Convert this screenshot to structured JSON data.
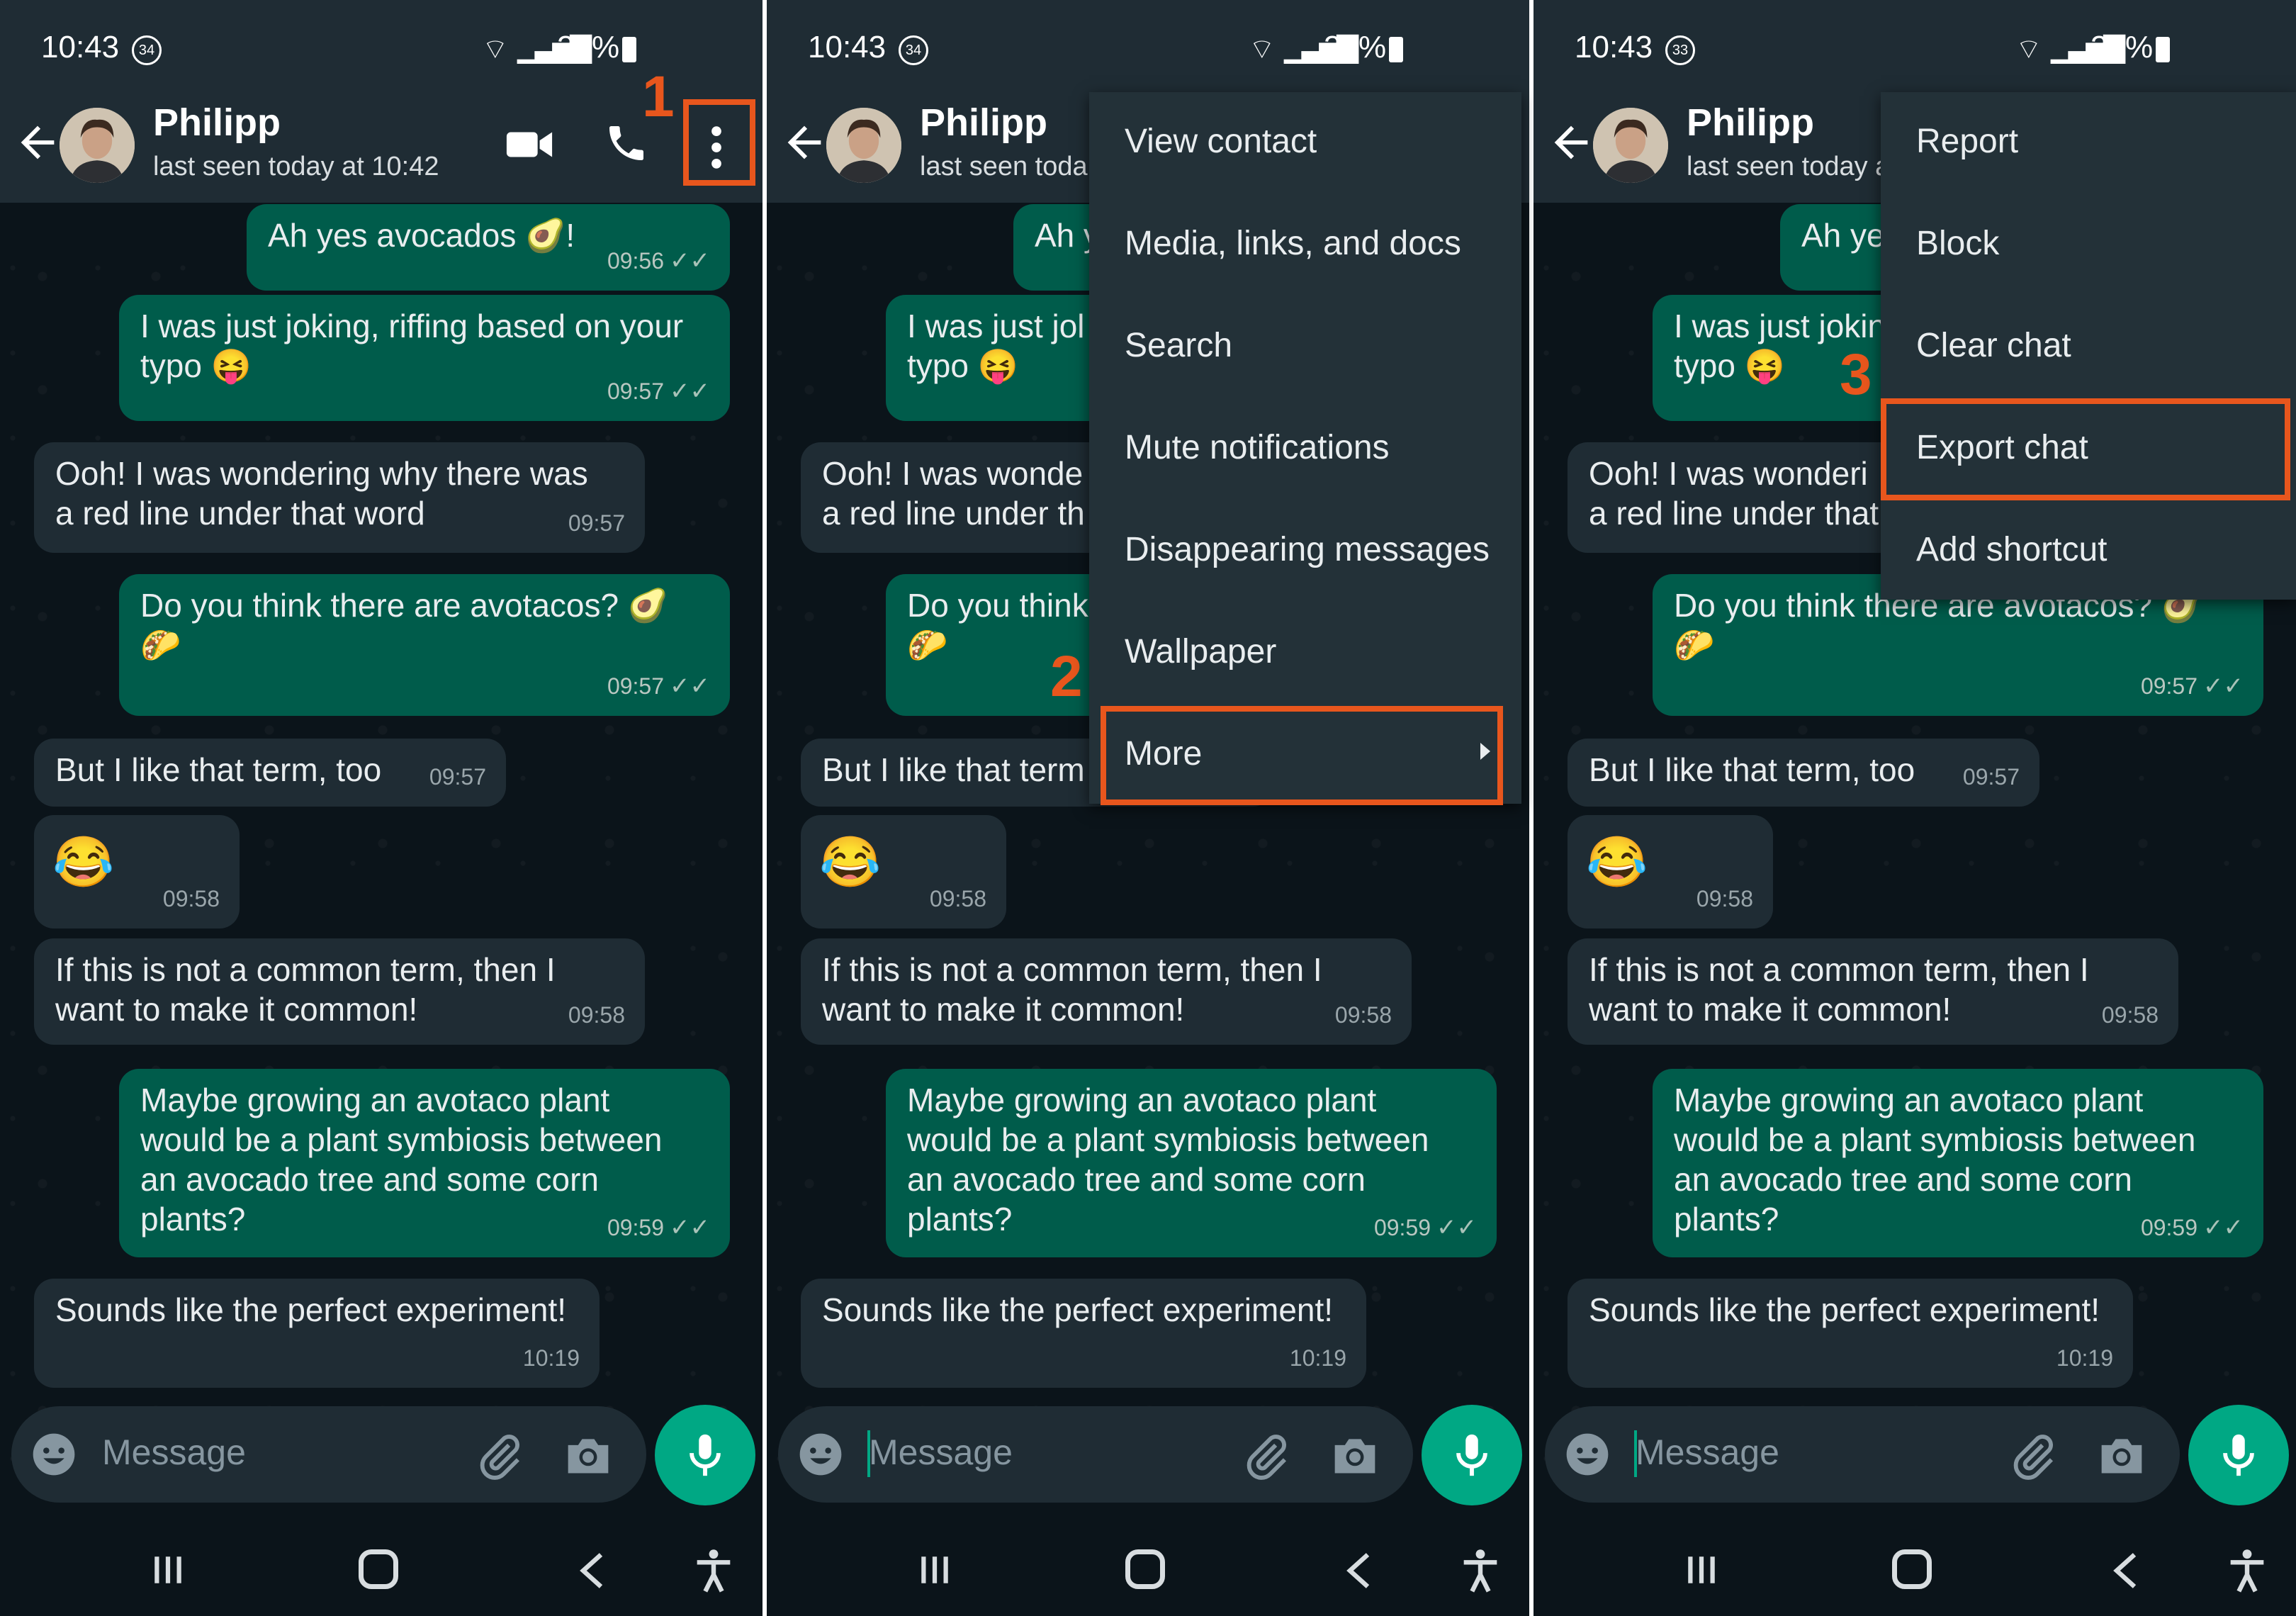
{
  "status": {
    "time": "10:43",
    "battery": [
      "34%",
      "34%",
      "33%"
    ],
    "notification_count": [
      "34",
      "34",
      "33"
    ]
  },
  "header": {
    "contact_name": "Philipp",
    "last_seen": "last seen today at 10:42",
    "last_seen_cut": "last seen toda",
    "last_seen_cut2": "last seen today a"
  },
  "messages": [
    {
      "dir": "out",
      "text": "Ah yes avocados 🥑!",
      "time": "09:56"
    },
    {
      "dir": "out",
      "text": "I was just joking, riffing based on your\ntypo 😝",
      "time": "09:57"
    },
    {
      "dir": "in",
      "text": "Ooh! I was wondering why there was\na red line under that word",
      "time": "09:57"
    },
    {
      "dir": "out",
      "text": "Do you think there are avotacos? 🥑\n🌮",
      "time": "09:57"
    },
    {
      "dir": "in",
      "text": "But I like that term, too",
      "time": "09:57"
    },
    {
      "dir": "in",
      "text": "😂",
      "time": "09:58"
    },
    {
      "dir": "in",
      "text": "If this is not a common term, then I\nwant to make it common!",
      "time": "09:58"
    },
    {
      "dir": "out",
      "text": "Maybe growing an avotaco plant\nwould be a plant symbiosis between\nan avocado tree and some corn\nplants?",
      "time": "09:59"
    },
    {
      "dir": "in",
      "text": "Sounds like the perfect experiment!",
      "time": "10:19"
    }
  ],
  "cut_messages": {
    "m1": "Ah y",
    "m1b": "Ah ye",
    "m2": "I was just jol\ntypo 😝",
    "m2b": "I was just jokin\ntypo 😝",
    "m3": "Ooh! I was wonde\na red line under th",
    "m3b": "Ooh! I was wonderi\na red line under that",
    "m4": "Do you think\n🌮",
    "m5": "But I like that term"
  },
  "input": {
    "placeholder": "Message"
  },
  "menu_main": [
    "View contact",
    "Media, links, and docs",
    "Search",
    "Mute notifications",
    "Disappearing messages",
    "Wallpaper",
    "More"
  ],
  "menu_more": [
    "Report",
    "Block",
    "Clear chat",
    "Export chat",
    "Add shortcut"
  ],
  "steps": [
    "1",
    "2",
    "3"
  ],
  "colors": {
    "highlight": "#e8561d",
    "accent": "#00a884",
    "outgoing": "#005c4b",
    "incoming": "#1f2c34"
  }
}
